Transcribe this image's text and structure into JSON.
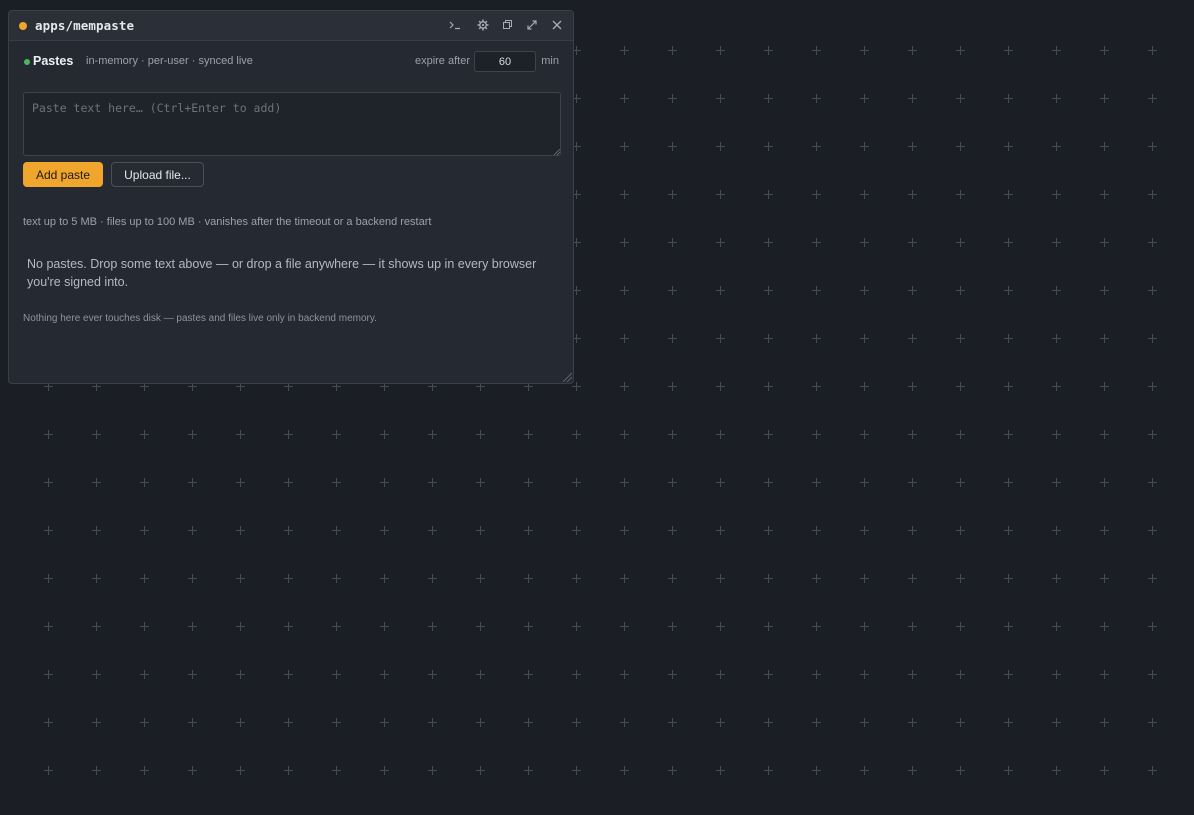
{
  "window": {
    "title": "apps/mempaste",
    "title_dot_color": "#f0a52c",
    "controls": [
      {
        "name": "terminal-icon",
        "glyph": ">_"
      },
      {
        "name": "gear-icon",
        "glyph": "⚙"
      },
      {
        "name": "copy-icon",
        "glyph": "⧉"
      },
      {
        "name": "expand-icon",
        "glyph": "⤢"
      },
      {
        "name": "close-icon",
        "glyph": "✕"
      }
    ]
  },
  "header": {
    "title": "Pastes",
    "status_color": "#4cb85c",
    "subtitle": "in-memory · per-user · synced live",
    "expire_label": "expire after",
    "expire_value": "60",
    "expire_unit": "min"
  },
  "paste_input": {
    "placeholder": "Paste text here… (Ctrl+Enter to add)",
    "value": ""
  },
  "actions": {
    "add_label": "Add paste",
    "upload_label": "Upload file..."
  },
  "limits_text": "text up to 5 MB · files up to 100 MB · vanishes after the timeout or a backend restart",
  "empty_state": "No pastes. Drop some text above — or drop a file anywhere — it shows up in every browser you're signed into.",
  "footer_note": "Nothing here ever touches disk — pastes and files live only in backend memory.",
  "colors": {
    "accent": "#f0a52c",
    "background": "#1b1e24",
    "panel": "#252a32"
  }
}
